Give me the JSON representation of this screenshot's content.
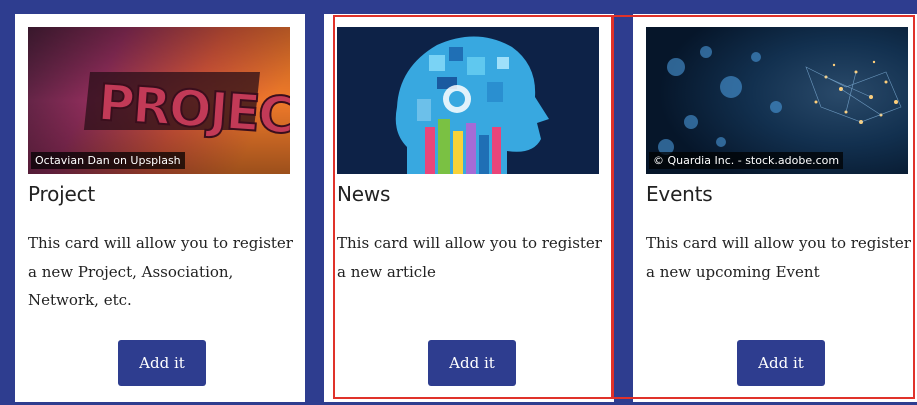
{
  "cards": [
    {
      "title": "Project",
      "text": "This card will allow you to register a new Project, Association, Network, etc.",
      "button": "Add it",
      "image_credit": "Octavian Dan on Upsplash",
      "image_text": "PROJECTS"
    },
    {
      "title": "News",
      "text": "This card will allow you to register a new article",
      "button": "Add it"
    },
    {
      "title": "Events",
      "text": "This card will allow you to register a new upcoming Event",
      "button": "Add it",
      "image_credit": "© Quardia Inc. - stock.adobe.com"
    }
  ],
  "colors": {
    "background": "#2e3d8f",
    "button": "#2e3d8f",
    "card": "#ffffff",
    "highlight": "#e0322a"
  }
}
